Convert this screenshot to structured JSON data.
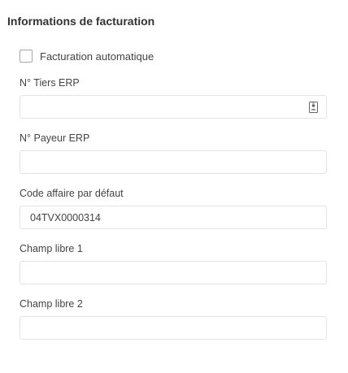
{
  "section": {
    "title": "Informations de facturation"
  },
  "auto_billing": {
    "label": "Facturation automatique",
    "checked": false
  },
  "fields": {
    "tiers_erp": {
      "label": "N° Tiers ERP",
      "value": "",
      "icon": "contact-card-icon"
    },
    "payeur_erp": {
      "label": "N° Payeur ERP",
      "value": ""
    },
    "code_affaire": {
      "label": "Code affaire par défaut",
      "value": "04TVX0000314"
    },
    "champ_libre_1": {
      "label": "Champ libre 1",
      "value": ""
    },
    "champ_libre_2": {
      "label": "Champ libre 2",
      "value": ""
    }
  },
  "colors": {
    "border": "#e3e3e3",
    "text": "#444444",
    "title": "#333333"
  }
}
